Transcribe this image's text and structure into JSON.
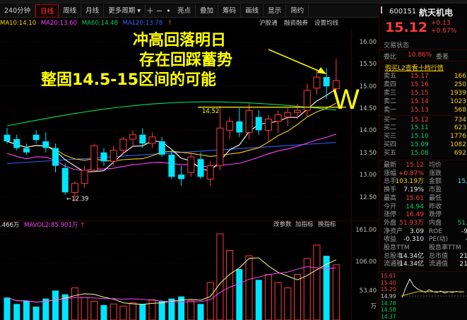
{
  "toolbar": {
    "items": [
      "240分钟",
      "日线",
      "周线",
      "月线",
      "更多周期"
    ],
    "icons": [
      "plus-icon",
      "minus-icon",
      "dot-icon"
    ],
    "tools": [
      "亮点",
      "叠加",
      "筹码",
      "画线",
      "显示",
      "简约"
    ],
    "active": "日线"
  },
  "legend": {
    "ma5_partial": "MA10:14.10",
    "ma10": "MA10:14.10",
    "ma20": "MA20:13.60",
    "ma60": "MA60:14.48",
    "ma120": "MA120:13.78",
    "arrow": "↑",
    "sub_tools": [
      "沪股通",
      "融资融券",
      "设置均线"
    ]
  },
  "annotations": {
    "line1": "冲高回落明日",
    "line2": "存在回踩蓄势",
    "line3": "整固14.5-15区间的可能",
    "support_label": "14.52",
    "low_label": "←12.39",
    "w_mark": "W"
  },
  "price_axis": [
    "16.00",
    "15.50",
    "15.00",
    "14.50",
    "14.00",
    "13.50",
    "13.00",
    "12.50"
  ],
  "volume_legend": {
    "vol": ".466万",
    "mavol": "MAVOL2:85.901万",
    "arrow": "↑",
    "tools": [
      "改参数",
      "加指标",
      "换指标"
    ]
  },
  "volume_axis": [
    "161.00",
    "106.00",
    "53.40",
    "万"
  ],
  "quote": {
    "code": "600151",
    "name": "航天机电",
    "price": "15.12",
    "change": "+0.13",
    "change_pct": "+0.87%",
    "status_label": "交易状态",
    "webi_label": "委比",
    "webi_value": "10.86%",
    "wecha_label": "委差",
    "l2_promo": "购买L2查看十档行情"
  },
  "order_book": {
    "asks": [
      {
        "label": "卖五",
        "price": "15.17",
        "vol": "166"
      },
      {
        "label": "卖四",
        "price": "15.16",
        "vol": "250"
      },
      {
        "label": "卖三",
        "price": "15.15",
        "vol": "1939"
      },
      {
        "label": "卖二",
        "price": "15.14",
        "vol": "1023"
      },
      {
        "label": "卖一",
        "price": "15.13",
        "vol": "568"
      }
    ],
    "bids": [
      {
        "label": "买一",
        "price": "15.12",
        "vol": "734"
      },
      {
        "label": "买二",
        "price": "15.11",
        "vol": "623"
      },
      {
        "label": "买三",
        "price": "15.10",
        "vol": "1776"
      },
      {
        "label": "买四",
        "price": "15.09",
        "vol": "1082"
      },
      {
        "label": "买五",
        "price": "15.08",
        "vol": "692"
      }
    ]
  },
  "stats": [
    {
      "l1": "最新",
      "v1": "15.12",
      "c1": "red",
      "l2": "均价",
      "v2": "",
      "c2": "red"
    },
    {
      "l1": "涨幅",
      "v1": "+0.87%",
      "c1": "red",
      "l2": "涨跌",
      "v2": "",
      "c2": "red"
    },
    {
      "l1": "总手",
      "v1": "103.19万",
      "c1": "yellow",
      "l2": "金额",
      "v2": "15.",
      "c2": "cyan"
    },
    {
      "l1": "换手",
      "v1": "7.19%",
      "c1": "white",
      "l2": "市盈",
      "v2": "",
      "c2": "white"
    },
    {
      "l1": "最高",
      "v1": "15.61",
      "c1": "red",
      "l2": "最低",
      "v2": "",
      "c2": "green"
    },
    {
      "l1": "今开",
      "v1": "14.94",
      "c1": "green",
      "l2": "昨收",
      "v2": "",
      "c2": "white"
    },
    {
      "l1": "涨停",
      "v1": "16.49",
      "c1": "red",
      "l2": "跌停",
      "v2": "",
      "c2": "green"
    },
    {
      "l1": "外盘",
      "v1": "51.93万",
      "c1": "red",
      "l2": "内盘",
      "v2": "51.",
      "c2": "green"
    },
    {
      "l1": "净资产",
      "v1": "3.09",
      "c1": "white",
      "l2": "ROE",
      "v2": "-9",
      "c2": "white"
    },
    {
      "l1": "收益",
      "v1": "-0.310",
      "c1": "white",
      "l2": "PE(动)",
      "v2": "-",
      "c2": "white"
    },
    {
      "l1": "股息TTM",
      "v1": "",
      "c1": "white",
      "l2": "股息率TTM",
      "v2": "",
      "c2": "white"
    },
    {
      "l1": "总股本",
      "v1": "14.34亿",
      "c1": "white",
      "l2": "总市值",
      "v2": "21",
      "c2": "white"
    },
    {
      "l1": "流通股",
      "v1": "14.34亿",
      "c1": "white",
      "l2": "流通值",
      "v2": "21",
      "c2": "white"
    }
  ],
  "mini_axis": [
    "15.61",
    "15.40",
    "15.20",
    "14.99",
    "14.78",
    "14.58",
    "14.37"
  ],
  "colors": {
    "up": "#ff3b3b",
    "down": "#00e5ff",
    "ma5": "#ffffff",
    "ma10": "#ffd400",
    "ma20": "#ff40ff",
    "ma60": "#00e060",
    "ma120": "#3060ff"
  },
  "chart_data": {
    "type": "candlestick",
    "ylim": [
      12.0,
      16.3
    ],
    "candles": [
      {
        "o": 13.9,
        "h": 14.05,
        "l": 13.7,
        "c": 13.75
      },
      {
        "o": 13.8,
        "h": 13.9,
        "l": 13.55,
        "c": 13.6
      },
      {
        "o": 13.6,
        "h": 13.7,
        "l": 13.45,
        "c": 13.5
      },
      {
        "o": 13.9,
        "h": 14.0,
        "l": 13.7,
        "c": 13.78
      },
      {
        "o": 13.75,
        "h": 13.95,
        "l": 13.5,
        "c": 13.6
      },
      {
        "o": 13.6,
        "h": 13.7,
        "l": 13.05,
        "c": 13.2
      },
      {
        "o": 13.15,
        "h": 13.25,
        "l": 12.55,
        "c": 12.6
      },
      {
        "o": 12.6,
        "h": 12.85,
        "l": 12.39,
        "c": 12.8
      },
      {
        "o": 12.8,
        "h": 13.2,
        "l": 12.7,
        "c": 13.1
      },
      {
        "o": 13.1,
        "h": 13.7,
        "l": 13.05,
        "c": 13.65
      },
      {
        "o": 13.5,
        "h": 13.6,
        "l": 13.2,
        "c": 13.3
      },
      {
        "o": 13.3,
        "h": 13.65,
        "l": 13.2,
        "c": 13.55
      },
      {
        "o": 13.55,
        "h": 13.85,
        "l": 13.45,
        "c": 13.8
      },
      {
        "o": 13.8,
        "h": 14.0,
        "l": 13.65,
        "c": 13.9
      },
      {
        "o": 13.9,
        "h": 14.05,
        "l": 13.6,
        "c": 13.7
      },
      {
        "o": 13.7,
        "h": 13.95,
        "l": 13.6,
        "c": 13.85
      },
      {
        "o": 13.75,
        "h": 13.85,
        "l": 13.4,
        "c": 13.45
      },
      {
        "o": 13.45,
        "h": 13.55,
        "l": 12.9,
        "c": 12.95
      },
      {
        "o": 13.0,
        "h": 13.2,
        "l": 12.75,
        "c": 12.9
      },
      {
        "o": 13.05,
        "h": 13.5,
        "l": 12.95,
        "c": 13.4
      },
      {
        "o": 13.35,
        "h": 13.5,
        "l": 12.9,
        "c": 12.95
      },
      {
        "o": 12.9,
        "h": 13.3,
        "l": 12.75,
        "c": 13.2
      },
      {
        "o": 13.2,
        "h": 14.55,
        "l": 13.1,
        "c": 14.05
      },
      {
        "o": 14.0,
        "h": 14.3,
        "l": 13.8,
        "c": 14.2
      },
      {
        "o": 14.2,
        "h": 14.5,
        "l": 13.85,
        "c": 13.95
      },
      {
        "o": 13.95,
        "h": 14.6,
        "l": 13.8,
        "c": 14.45
      },
      {
        "o": 14.3,
        "h": 14.45,
        "l": 13.9,
        "c": 14.0
      },
      {
        "o": 14.0,
        "h": 14.35,
        "l": 13.75,
        "c": 14.25
      },
      {
        "o": 14.2,
        "h": 14.45,
        "l": 13.95,
        "c": 14.35
      },
      {
        "o": 14.3,
        "h": 14.5,
        "l": 14.1,
        "c": 14.4
      },
      {
        "o": 14.4,
        "h": 14.6,
        "l": 14.25,
        "c": 14.45
      },
      {
        "o": 14.45,
        "h": 15.05,
        "l": 14.3,
        "c": 14.9
      },
      {
        "o": 14.95,
        "h": 15.35,
        "l": 14.8,
        "c": 15.2
      },
      {
        "o": 15.2,
        "h": 15.4,
        "l": 14.7,
        "c": 14.99
      },
      {
        "o": 14.94,
        "h": 15.61,
        "l": 14.9,
        "c": 15.12
      }
    ],
    "volume": [
      42,
      30,
      36,
      25,
      40,
      55,
      48,
      60,
      42,
      35,
      28,
      30,
      26,
      32,
      30,
      38,
      35,
      40,
      44,
      36,
      30,
      70,
      161,
      130,
      95,
      120,
      75,
      85,
      70,
      60,
      85,
      115,
      140,
      120,
      103.19
    ],
    "support_level": 14.52
  }
}
